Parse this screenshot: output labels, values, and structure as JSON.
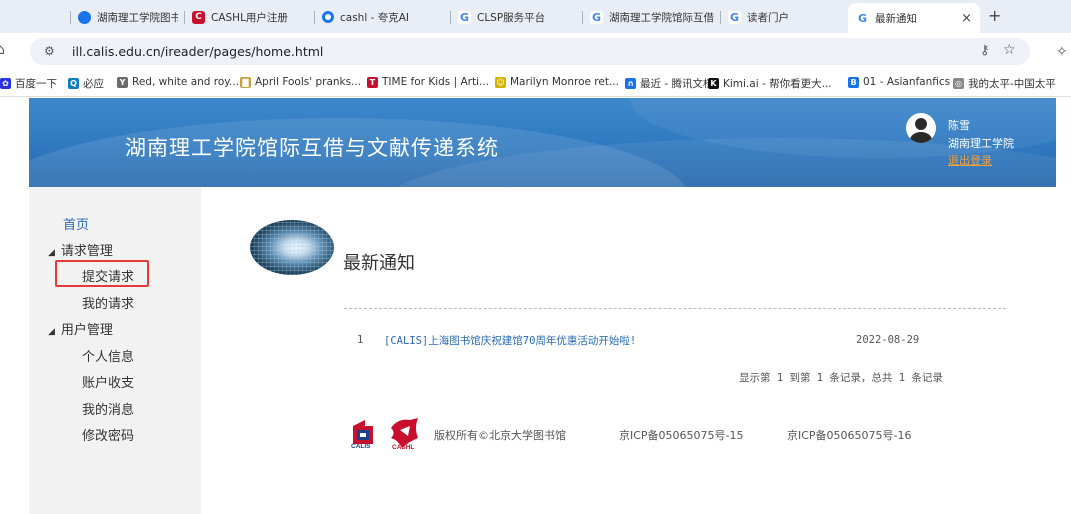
{
  "browser": {
    "tabs": [
      {
        "label": "湖南理工学院图书馆",
        "icon": "globe-icon"
      },
      {
        "label": "CASHL用户注册",
        "icon": "cashl-icon"
      },
      {
        "label": "cashl - 夸克AI",
        "icon": "quark-icon"
      },
      {
        "label": "CLSP服务平台",
        "icon": "google-icon"
      },
      {
        "label": "湖南理工学院馆际互借",
        "icon": "google-icon"
      },
      {
        "label": "读者门户",
        "icon": "google-icon"
      },
      {
        "label": "最新通知",
        "icon": "google-icon",
        "active": true
      }
    ],
    "close_glyph": "×",
    "newtab_glyph": "+",
    "url": "ill.calis.edu.cn/ireader/pages/home.html",
    "bookmarks": [
      {
        "label": "百度一下",
        "color": "#2932e1"
      },
      {
        "label": "必应",
        "color": "#0f7dc2"
      },
      {
        "label": "Red, white and roy...",
        "color": "#6a6a6a"
      },
      {
        "label": "April Fools' pranks...",
        "color": "#c8a03a"
      },
      {
        "label": "TIME for Kids | Arti...",
        "color": "#c8102e"
      },
      {
        "label": "Marilyn Monroe ret...",
        "color": "#d4b400"
      },
      {
        "label": "最近 - 腾讯文档",
        "color": "#1a73e8"
      },
      {
        "label": "Kimi.ai - 帮你看更大...",
        "color": "#111111"
      },
      {
        "label": "01 - Asianfanfics",
        "color": "#1a73e8"
      },
      {
        "label": "我的太平-中国太平",
        "color": "#888888"
      }
    ]
  },
  "header": {
    "site_title": "湖南理工学院馆际互借与文献传递系统",
    "user_name": "陈雪",
    "user_org": "湖南理工学院",
    "logout_label": "退出登录"
  },
  "sidebar": {
    "home": "首页",
    "request_group": "请求管理",
    "submit_request": "提交请求",
    "my_requests": "我的请求",
    "user_group": "用户管理",
    "profile": "个人信息",
    "billing": "账户收支",
    "messages": "我的消息",
    "change_password": "修改密码"
  },
  "main": {
    "section_title": "最新通知",
    "notices": [
      {
        "index": "1",
        "title": "[CALIS]上海图书馆庆祝建馆70周年优惠活动开始啦!",
        "date": "2022-08-29"
      }
    ],
    "pager_text": "显示第 1 到第 1 条记录，总共 1 条记录"
  },
  "footer": {
    "calis_logo_text": "CALIS",
    "cashl_logo_text": "CASHL",
    "copyright": "版权所有©北京大学图书馆",
    "icp1": "京ICP备05065075号-15",
    "icp2": "京ICP备05065075号-16"
  },
  "colors": {
    "banner": "#3380c6",
    "link": "#2a6ab8",
    "logout": "#f4a13c",
    "highlight": "#e63a3a"
  }
}
